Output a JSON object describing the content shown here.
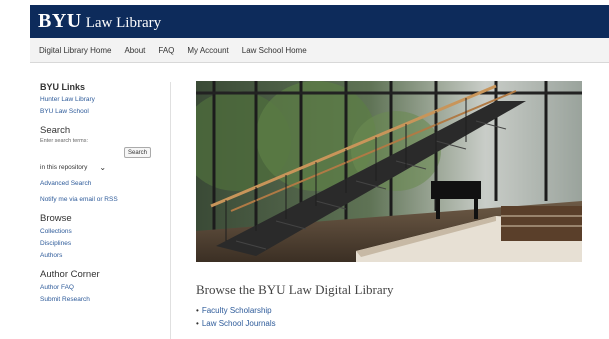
{
  "header": {
    "brand_bold": "BYU",
    "brand_rest": "Law Library"
  },
  "nav": [
    {
      "label": "Digital Library Home"
    },
    {
      "label": "About"
    },
    {
      "label": "FAQ"
    },
    {
      "label": "My Account"
    },
    {
      "label": "Law School Home"
    }
  ],
  "sidebar": {
    "byu_links": {
      "title": "BYU Links",
      "items": [
        "Hunter Law Library",
        "BYU Law School"
      ]
    },
    "search": {
      "title": "Search",
      "hint": "Enter search terms:",
      "button": "Search",
      "scope": "in this repository",
      "advanced": "Advanced Search",
      "notify": "Notify me via email or RSS"
    },
    "browse": {
      "title": "Browse",
      "items": [
        "Collections",
        "Disciplines",
        "Authors"
      ]
    },
    "author_corner": {
      "title": "Author Corner",
      "items": [
        "Author FAQ",
        "Submit Research"
      ]
    }
  },
  "main": {
    "title": "Browse the BYU Law Digital Library",
    "links": [
      "Faculty Scholarship",
      "Law School Journals"
    ]
  },
  "colors": {
    "header_bg": "#0d2b5b",
    "link": "#2e5b9a"
  }
}
